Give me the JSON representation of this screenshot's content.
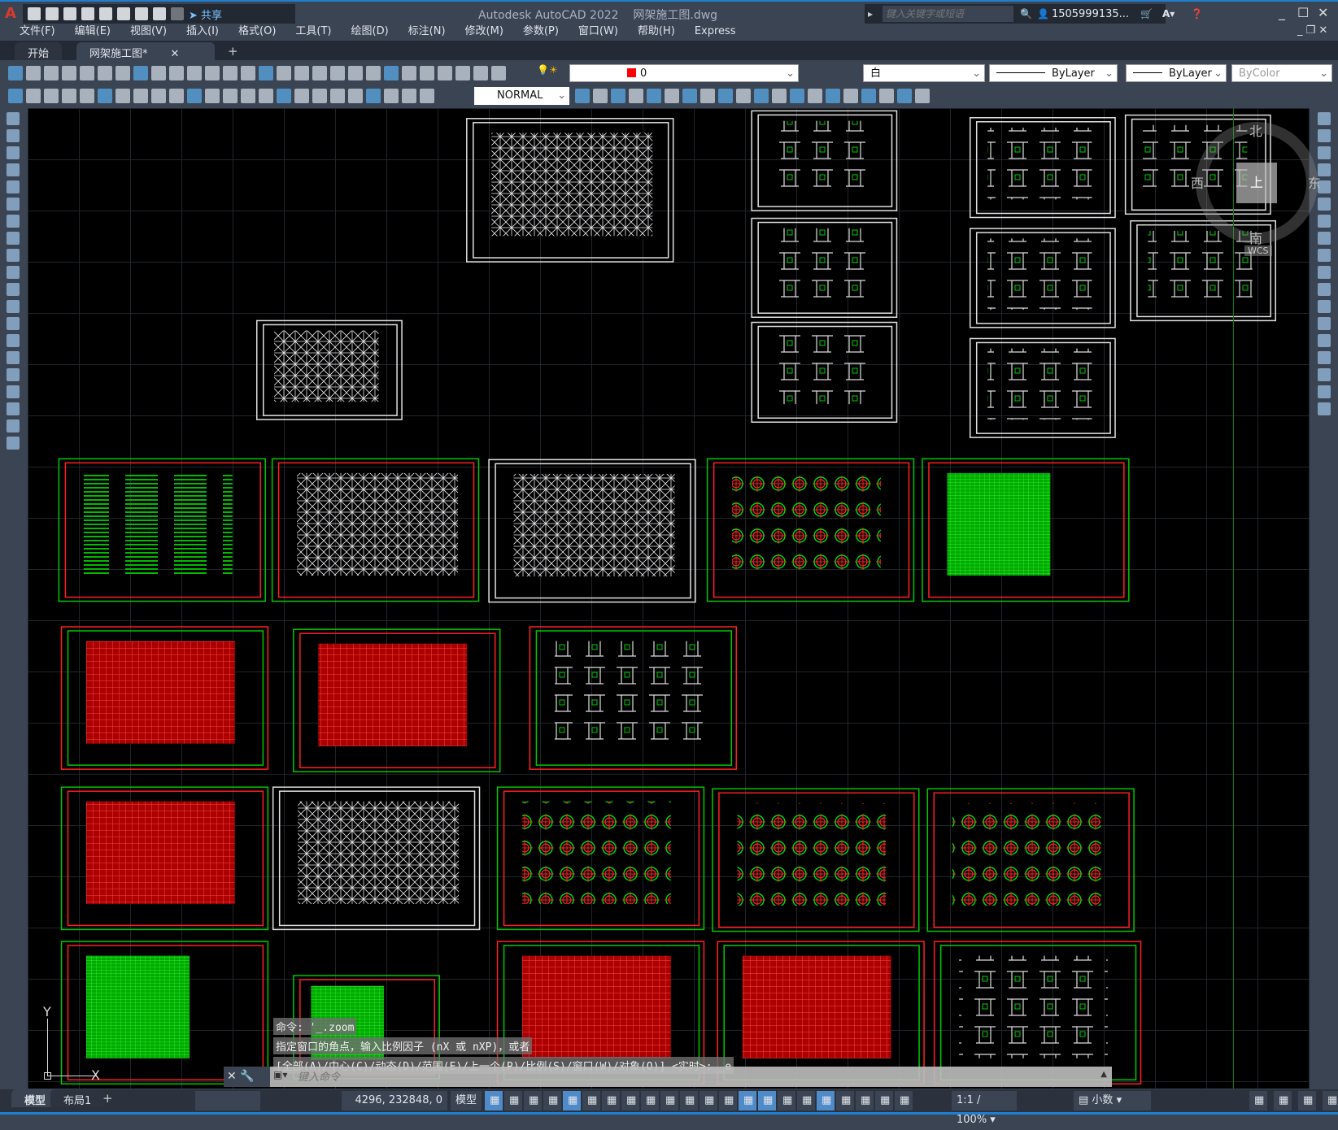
{
  "app": {
    "title": "Autodesk AutoCAD 2022",
    "filename": "网架施工图.dwg",
    "logo": "A",
    "share": "共享"
  },
  "search": {
    "placeholder": "键入关键字或短语"
  },
  "user": {
    "name": "1505999135..."
  },
  "menu": [
    "文件(F)",
    "编辑(E)",
    "视图(V)",
    "插入(I)",
    "格式(O)",
    "工具(T)",
    "绘图(D)",
    "标注(N)",
    "修改(M)",
    "参数(P)",
    "窗口(W)",
    "帮助(H)",
    "Express"
  ],
  "tabs": [
    {
      "label": "开始",
      "active": false
    },
    {
      "label": "网架施工图*",
      "active": true
    }
  ],
  "toolbar": {
    "layer": "0",
    "color": "白",
    "linetype": "ByLayer",
    "lineweight": "ByLayer",
    "plotstyle": "ByColor",
    "dimstyle": "NORMAL",
    "layer_color": "#ff0000"
  },
  "viewcube": {
    "north": "北",
    "south": "南",
    "east": "东",
    "west": "西",
    "top": "上",
    "wcs": "WCS"
  },
  "ucs": {
    "x": "X",
    "y": "Y"
  },
  "command": {
    "history": [
      "命令: '_.zoom",
      "指定窗口的角点，输入比例因子 (nX 或 nXP)，或者",
      "[全部(A)/中心(C)/动态(D)/范围(E)/上一个(P)/比例(S)/窗口(W)/对象(O)] <实时>: _e"
    ],
    "placeholder": "键入命令"
  },
  "layout_tabs": [
    "模型",
    "布局1"
  ],
  "status": {
    "coords": "4296, 232848, 0",
    "space": "模型",
    "scale": "1:1 / 100%",
    "units": "小数"
  },
  "colors": {
    "canvas": "#000000",
    "frame_green": "#00c800",
    "frame_red": "#ff0000",
    "accent": "#1e7fd0"
  }
}
